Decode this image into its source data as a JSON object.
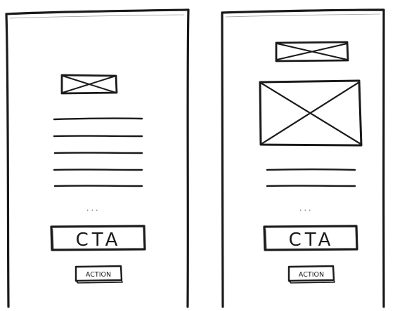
{
  "wireframes": [
    {
      "cta_label": "CTA",
      "action_label": "ACTION",
      "ellipsis": "...",
      "text_lines": 5,
      "image_placeholders": 1
    },
    {
      "cta_label": "CTA",
      "action_label": "ACTION",
      "ellipsis": "...",
      "text_lines": 2,
      "image_placeholders": 2
    }
  ],
  "colors": {
    "ink": "#1a1a1a",
    "paper": "#ffffff"
  }
}
